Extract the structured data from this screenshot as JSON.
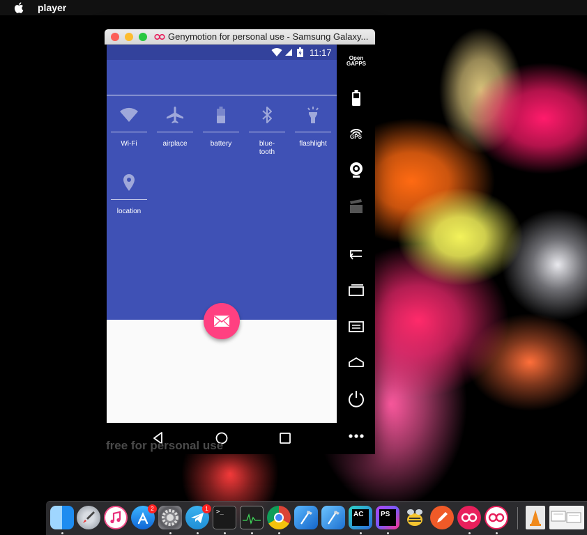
{
  "menubar": {
    "app_name": "player"
  },
  "window": {
    "title": "Genymotion for personal use - Samsung Galaxy..."
  },
  "statusbar": {
    "time": "11:17"
  },
  "tiles": [
    {
      "label": "Wi-Fi",
      "icon": "wifi-icon"
    },
    {
      "label": "airplace",
      "icon": "airplane-icon"
    },
    {
      "label": "battery",
      "icon": "battery-icon"
    },
    {
      "label": "blue-\ntooth",
      "icon": "bluetooth-icon"
    },
    {
      "label": "flashlight",
      "icon": "flashlight-icon"
    },
    {
      "label": "location",
      "icon": "location-icon"
    }
  ],
  "sidebar": {
    "opengapps": "Open\nGAPPS",
    "gps": "GPS"
  },
  "watermark": "free for personal use",
  "dock": {
    "badges": {
      "appstore": "2",
      "telegram": "1"
    },
    "terminal_prompt": ">_",
    "ac_label": "AC",
    "ps_label": "PS"
  },
  "colors": {
    "primary": "#3f51b5",
    "primary_dark": "#33429c",
    "accent": "#ff4081"
  }
}
